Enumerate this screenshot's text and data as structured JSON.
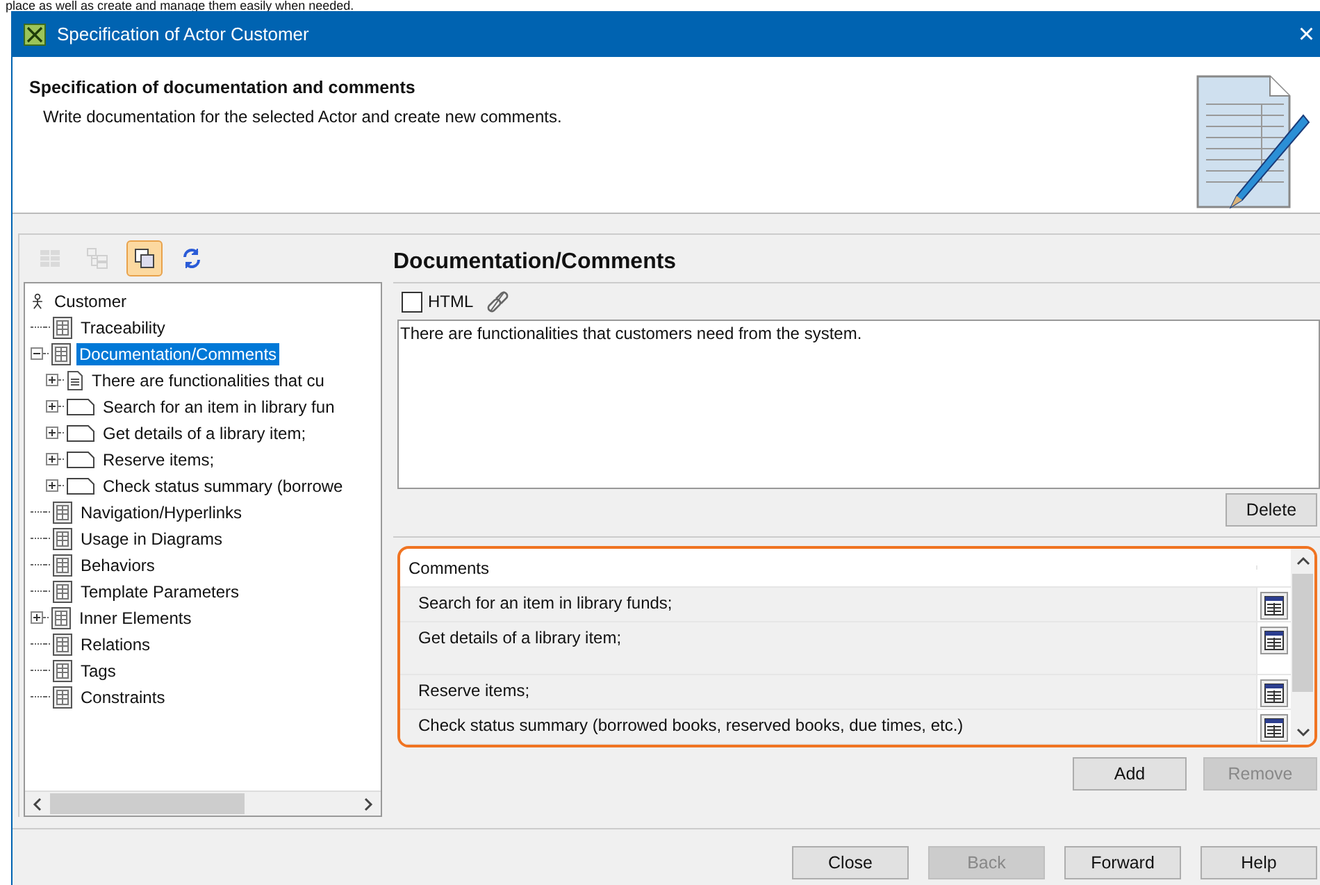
{
  "page_text": "place as well as create and manage them easily when needed.",
  "window": {
    "title": "Specification of Actor Customer",
    "close": "×"
  },
  "header": {
    "title": "Specification of documentation and comments",
    "description": "Write documentation for the selected Actor and create new comments."
  },
  "toolbar": [
    {
      "kind": "grid",
      "disabled": true,
      "selected": false
    },
    {
      "kind": "tree",
      "disabled": true,
      "selected": false
    },
    {
      "kind": "copy",
      "disabled": false,
      "selected": true
    },
    {
      "kind": "refresh",
      "disabled": false,
      "selected": false
    }
  ],
  "tree": {
    "label": "Customer",
    "kind": "actor",
    "children": [
      {
        "label": "Traceability",
        "kind": "page",
        "selected": false
      },
      {
        "label": "Documentation/Comments",
        "kind": "page",
        "selected": true,
        "expanded": true,
        "children": [
          {
            "label": "There are functionalities that cu",
            "kind": "note",
            "selected": false,
            "expanded": false
          },
          {
            "label": "Search for an item in library fun",
            "kind": "comment",
            "selected": false,
            "expanded": false
          },
          {
            "label": "Get details of a library item;",
            "kind": "comment",
            "selected": false,
            "expanded": false
          },
          {
            "label": "Reserve items;",
            "kind": "comment",
            "selected": false,
            "expanded": false
          },
          {
            "label": "Check status summary (borrowe",
            "kind": "comment",
            "selected": false,
            "expanded": false
          }
        ]
      },
      {
        "label": "Navigation/Hyperlinks",
        "kind": "page",
        "selected": false
      },
      {
        "label": "Usage in Diagrams",
        "kind": "page",
        "selected": false
      },
      {
        "label": "Behaviors",
        "kind": "page",
        "selected": false
      },
      {
        "label": "Template Parameters",
        "kind": "page",
        "selected": false
      },
      {
        "label": "Inner Elements",
        "kind": "page",
        "selected": false,
        "expanded": false
      },
      {
        "label": "Relations",
        "kind": "page",
        "selected": false
      },
      {
        "label": "Tags",
        "kind": "page",
        "selected": false
      },
      {
        "label": "Constraints",
        "kind": "page",
        "selected": false
      }
    ]
  },
  "panel": {
    "title": "Documentation/Comments",
    "html_checkbox": {
      "label": "HTML",
      "checked": false
    },
    "documentation": "There are functionalities that customers need from the system.",
    "delete_button": "Delete",
    "comments": {
      "column": "Comments",
      "rows": [
        {
          "text": "Search for an item in library funds;",
          "tall": false
        },
        {
          "text": "Get details of a library item;",
          "tall": true
        },
        {
          "text": "Reserve items;",
          "tall": false
        },
        {
          "text": "Check status summary (borrowed books, reserved books, due times, etc.)",
          "tall": false
        }
      ]
    },
    "buttons": [
      {
        "label": "Add",
        "disabled": false
      },
      {
        "label": "Remove",
        "disabled": true
      }
    ]
  },
  "footer_buttons": [
    {
      "label": "Close",
      "disabled": false
    },
    {
      "label": "Back",
      "disabled": true
    },
    {
      "label": "Forward",
      "disabled": false
    },
    {
      "label": "Help",
      "disabled": false
    }
  ]
}
